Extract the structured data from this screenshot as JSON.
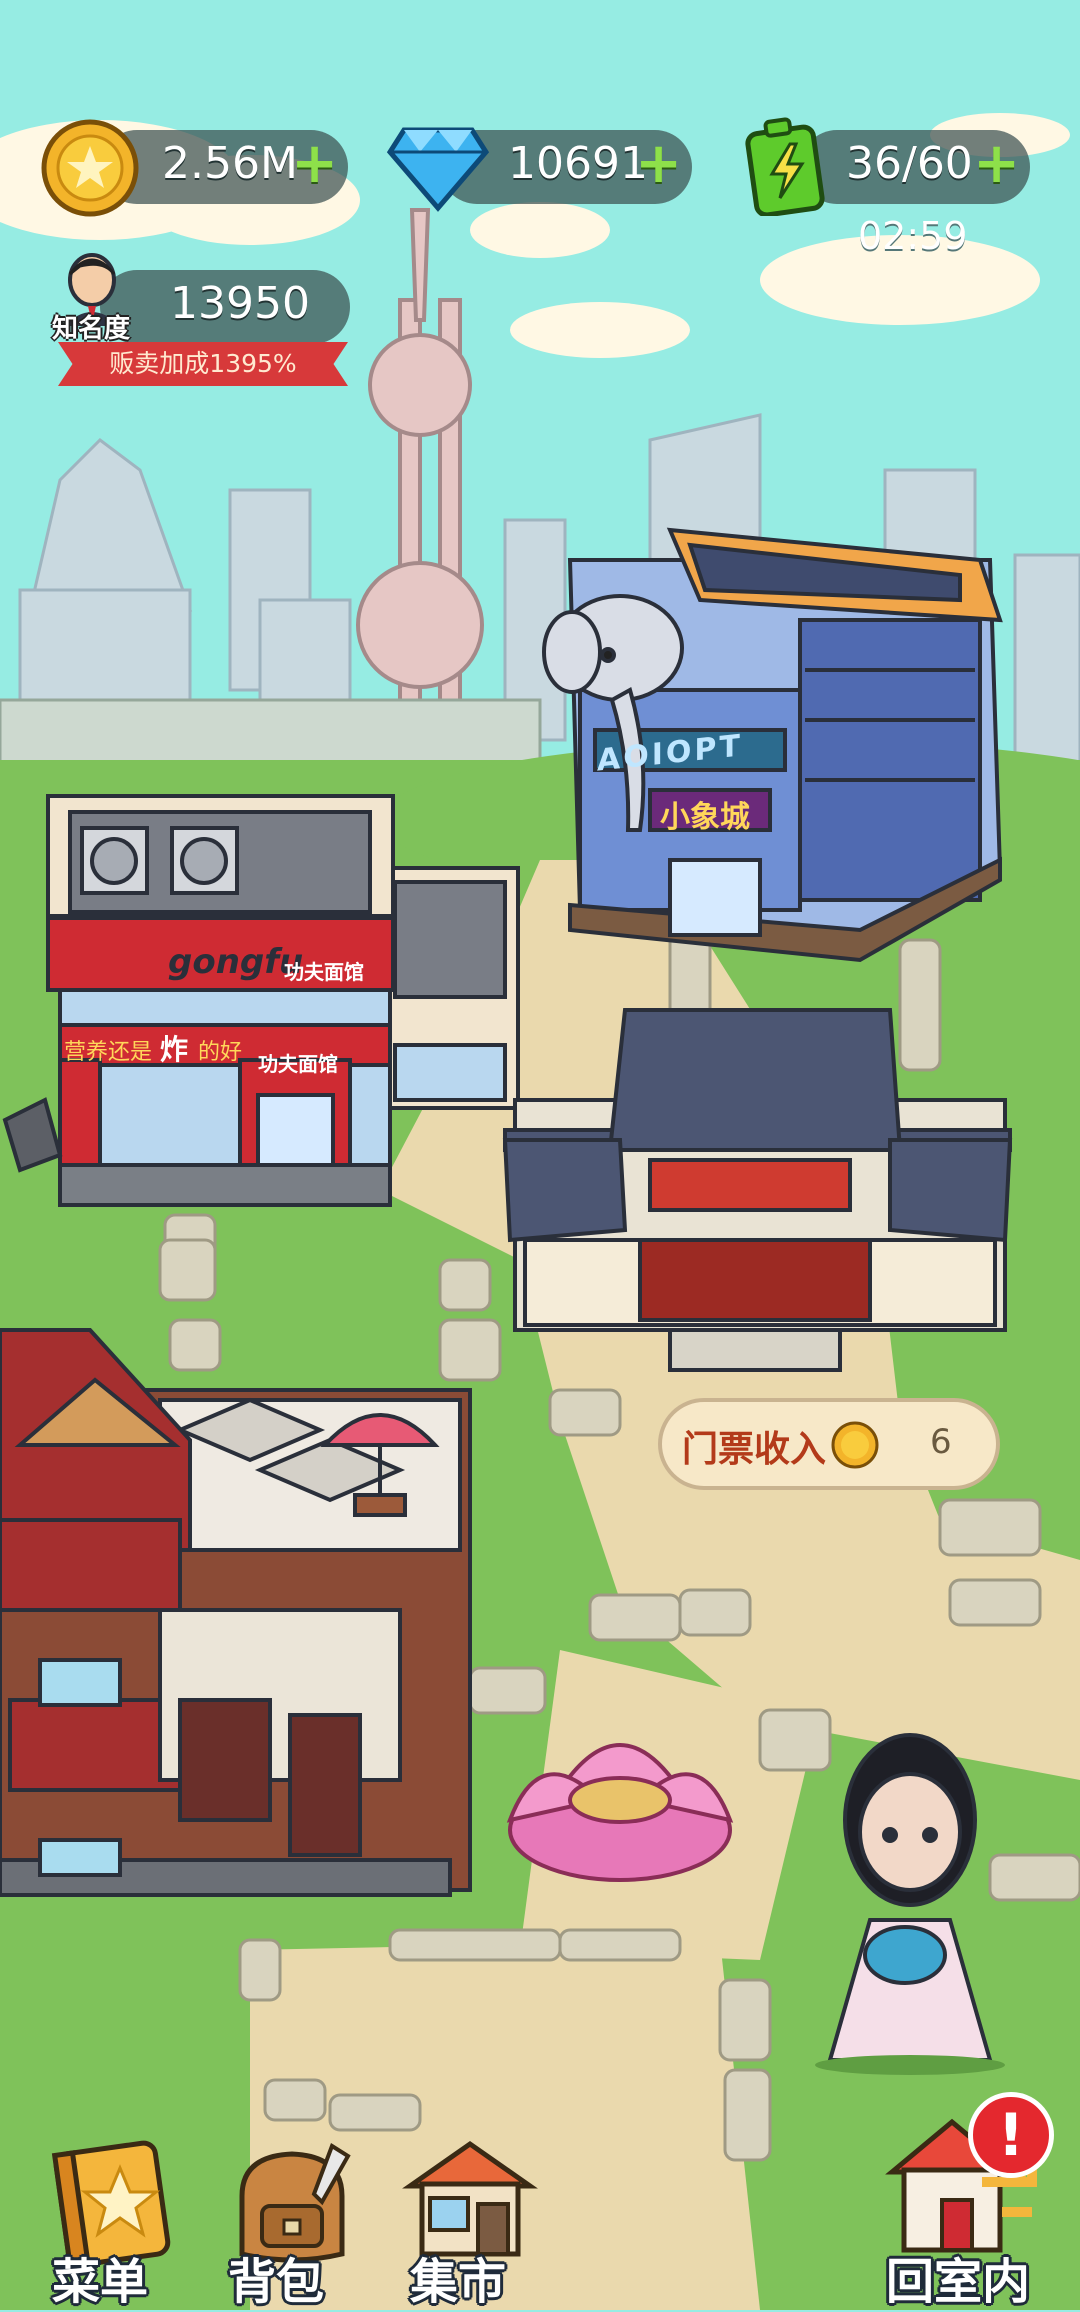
{
  "hud": {
    "coins": "2.56M",
    "gems": "10691",
    "energy": "36/60",
    "energy_timer": "02:59",
    "fame_label": "知名度",
    "fame_value": "13950",
    "sale_bonus": "贩卖加成1395%"
  },
  "buildings": {
    "mall_sign": "小象城",
    "mall_letters": "AOIOPT",
    "noodle_brand": "gongfu",
    "noodle_name_top": "功夫面馆",
    "noodle_name_door": "功夫面馆",
    "noodle_slogan_a": "营养还是",
    "noodle_slogan_b": "炸",
    "noodle_slogan_c": "的好"
  },
  "ticket_income": {
    "label": "门票收入",
    "value": "6"
  },
  "nav": {
    "menu": "菜单",
    "backpack": "背包",
    "market": "集市",
    "go_indoor": "回室内"
  },
  "alert_mark": "!",
  "colors": {
    "sky": "#96ece3",
    "grass": "#7fc25a",
    "path": "#ead9ad",
    "plus_green": "#8ee04a",
    "ribbon_red": "#d7393a"
  }
}
